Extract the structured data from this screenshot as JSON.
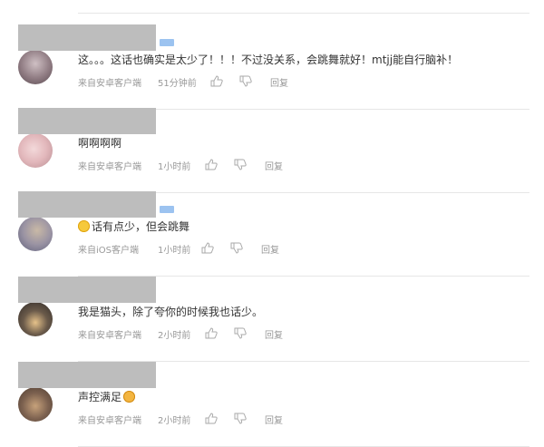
{
  "comments": [
    {
      "text": "这。。。这话也确实是太少了！！！不过没关系，会跳舞就好！mtjj能自行脑补！",
      "source": "来自安卓客户端",
      "time": "51分钟前",
      "reply": "回复",
      "badge": true,
      "avatar_colors": [
        "#5a4b52",
        "#cfc0c4"
      ]
    },
    {
      "text": "啊啊啊啊",
      "source": "来自安卓客户端",
      "time": "1小时前",
      "reply": "回复",
      "badge": false,
      "avatar_colors": [
        "#e7c3c6",
        "#c9a3a8"
      ]
    },
    {
      "text": "话有点少，但会跳舞",
      "source": "来自iOS客户端",
      "time": "1小时前",
      "reply": "回复",
      "badge": true,
      "emoji_lead": "smile-emoji",
      "avatar_colors": [
        "#7d7e9a",
        "#c9b9a6"
      ]
    },
    {
      "text": "我是猫头，除了夸你的时候我也话少。",
      "source": "来自安卓客户端",
      "time": "2小时前",
      "reply": "回复",
      "badge": false,
      "avatar_colors": [
        "#2f2a28",
        "#e6c28a"
      ]
    },
    {
      "text": "声控满足",
      "source": "来自安卓客户端",
      "time": "2小时前",
      "reply": "回复",
      "badge": false,
      "emoji_trail": "surprised-emoji",
      "avatar_colors": [
        "#4b3a2f",
        "#c7a27b"
      ]
    }
  ],
  "icons": {
    "like": "thumbs-up-icon",
    "dislike": "thumbs-down-icon"
  }
}
